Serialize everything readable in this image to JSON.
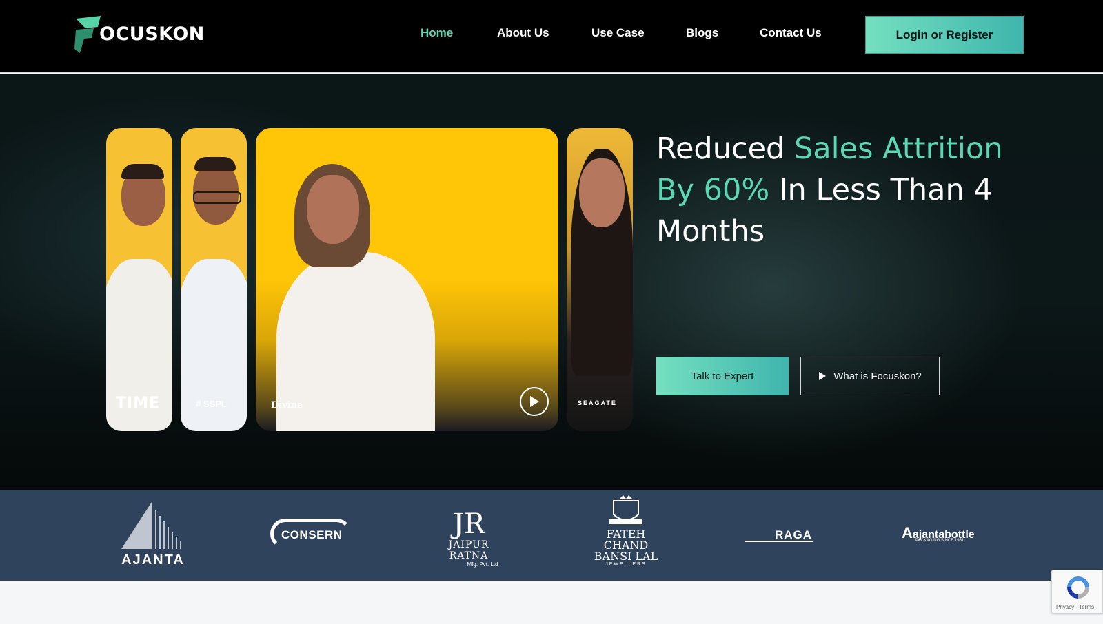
{
  "header": {
    "logo_text": "OCUSKON",
    "nav": [
      {
        "label": "Home",
        "active": true
      },
      {
        "label": "About Us",
        "active": false
      },
      {
        "label": "Use Case",
        "active": false
      },
      {
        "label": "Blogs",
        "active": false
      },
      {
        "label": "Contact Us",
        "active": false
      }
    ],
    "login_label": "Login or Register"
  },
  "hero": {
    "headline_1": "Reduced ",
    "headline_2": "Sales Attrition By 60%",
    "headline_3": " In Less Than 4 Months",
    "talk_label": "Talk to Expert",
    "what_label": "What is Focuskon?",
    "cards": [
      {
        "brand": "TIME"
      },
      {
        "brand": "SSPL"
      },
      {
        "brand": "Divine"
      },
      {
        "brand": "SEAGATE"
      }
    ]
  },
  "clients": [
    {
      "name": "AJANTA"
    },
    {
      "name": "CONSERN"
    },
    {
      "name": "JR",
      "sub": "JAIPUR RATNA",
      "sub2": "Mfg. Pvt. Ltd"
    },
    {
      "name": "FATEH CHAND",
      "sub": "BANSI LAL",
      "sub2": "JEWELLERS"
    },
    {
      "name": "RAGA"
    },
    {
      "name": "ajantabottle",
      "sub": "PACKAGING SINCE 1981"
    }
  ],
  "recaptcha": {
    "terms": "Privacy - Terms"
  },
  "colors": {
    "accent": "#5cd6b4",
    "band": "#30435c",
    "header": "#000000"
  }
}
